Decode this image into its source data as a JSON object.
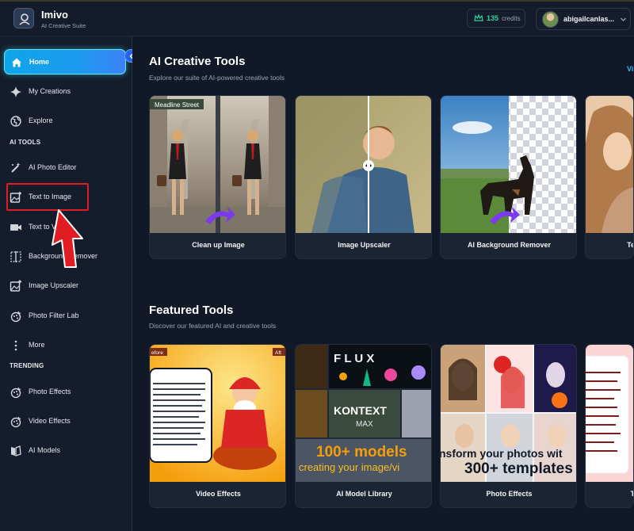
{
  "app": {
    "name": "Imivo",
    "subtitle": "AI Creative Suite",
    "accent": "#0ea5e9"
  },
  "header": {
    "credits_value": "135",
    "credits_label": "credits",
    "user_name": "abigailcanlas..."
  },
  "sidebar": {
    "items": [
      {
        "label": "Home",
        "icon": "home-icon"
      },
      {
        "label": "My Creations",
        "icon": "sparkle-icon"
      },
      {
        "label": "Explore",
        "icon": "globe-icon"
      }
    ],
    "ai_tools_label": "AI TOOLS",
    "ai_tools": [
      {
        "label": "AI Photo Editor",
        "icon": "magic-wand-icon"
      },
      {
        "label": "Text to Image",
        "icon": "image-add-icon"
      },
      {
        "label": "Text to Video",
        "icon": "video-icon"
      },
      {
        "label": "Background Remover",
        "icon": "split-frame-icon"
      },
      {
        "label": "Image Upscaler",
        "icon": "image-up-icon"
      },
      {
        "label": "Photo Filter Lab",
        "icon": "filter-icon"
      },
      {
        "label": "More",
        "icon": "more-vertical-icon"
      }
    ],
    "trending_label": "TRENDING",
    "trending": [
      {
        "label": "Photo Effects",
        "icon": "palette-icon"
      },
      {
        "label": "Video Effects",
        "icon": "palette-icon"
      },
      {
        "label": "AI Models",
        "icon": "models-icon"
      }
    ]
  },
  "creative_tools": {
    "title": "AI Creative Tools",
    "subtitle": "Explore our suite of AI-powered creative tools",
    "view_link": "Vi",
    "cards": [
      {
        "label": "Clean up Image",
        "sign_text": "Meadline Street"
      },
      {
        "label": "Image Upscaler"
      },
      {
        "label": "AI Background Remover"
      },
      {
        "label": "Te"
      }
    ]
  },
  "featured": {
    "title": "Featured Tools",
    "subtitle": "Discover our featured AI and creative tools",
    "cards": [
      {
        "label": "Video Effects",
        "badge": "efore",
        "badge2": "Aft"
      },
      {
        "label": "AI Model Library",
        "overlay_main": "100+ models",
        "overlay_sub": "creating your image/vi",
        "kontext": "KONTEXT",
        "max": "MAX",
        "flux": "F L U X"
      },
      {
        "label": "Photo Effects",
        "overlay_line1": "nsform your photos wit",
        "overlay_line2": "300+ templates"
      },
      {
        "label": "T"
      }
    ]
  }
}
